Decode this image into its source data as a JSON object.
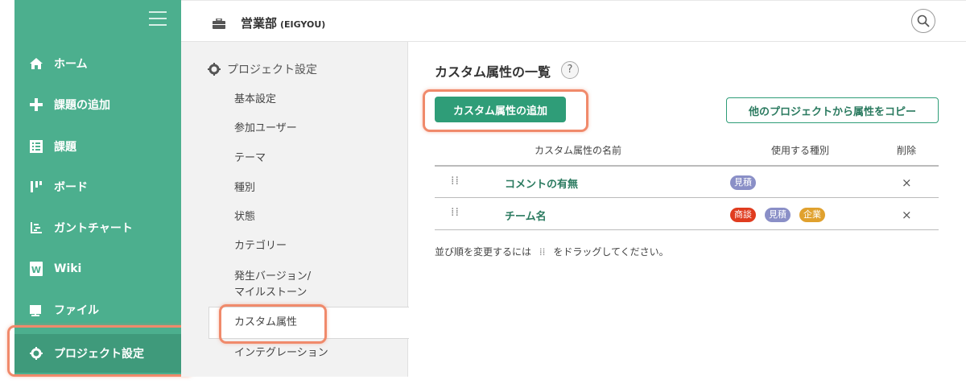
{
  "sidebar": {
    "items": [
      {
        "label": "ホーム",
        "icon": "home-icon"
      },
      {
        "label": "課題の追加",
        "icon": "plus-icon"
      },
      {
        "label": "課題",
        "icon": "list-icon"
      },
      {
        "label": "ボード",
        "icon": "board-icon"
      },
      {
        "label": "ガントチャート",
        "icon": "gantt-icon"
      },
      {
        "label": "Wiki",
        "icon": "wiki-icon"
      },
      {
        "label": "ファイル",
        "icon": "folder-icon"
      },
      {
        "label": "プロジェクト設定",
        "icon": "gear-icon"
      }
    ]
  },
  "header": {
    "project_name": "営業部",
    "project_key": "(EIGYOU)"
  },
  "submenu": {
    "title": "プロジェクト設定",
    "items": [
      "基本設定",
      "参加ユーザー",
      "テーマ",
      "種別",
      "状態",
      "カテゴリー",
      "発生バージョン/",
      "マイルストーン",
      "カスタム属性",
      "インテグレーション"
    ]
  },
  "main": {
    "title": "カスタム属性の一覧",
    "help": "?",
    "add_button": "カスタム属性の追加",
    "copy_button": "他のプロジェクトから属性をコピー",
    "columns": {
      "name": "カスタム属性の名前",
      "type": "使用する種別",
      "delete": "削除"
    },
    "rows": [
      {
        "name": "コメントの有無",
        "types": [
          "見積"
        ]
      },
      {
        "name": "チーム名",
        "types": [
          "商談",
          "見積",
          "企業"
        ]
      }
    ],
    "delete_mark": "×",
    "note_before": "並び順を変更するには",
    "note_after": "をドラッグしてください。"
  },
  "colors": {
    "sidebar": "#4caf8e",
    "accent": "#2f9d78",
    "highlight": "#f08a6b",
    "badge_mitsumori": "#8a8fc7",
    "badge_shodan": "#e03c1f",
    "badge_kigyo": "#e0a12e"
  }
}
